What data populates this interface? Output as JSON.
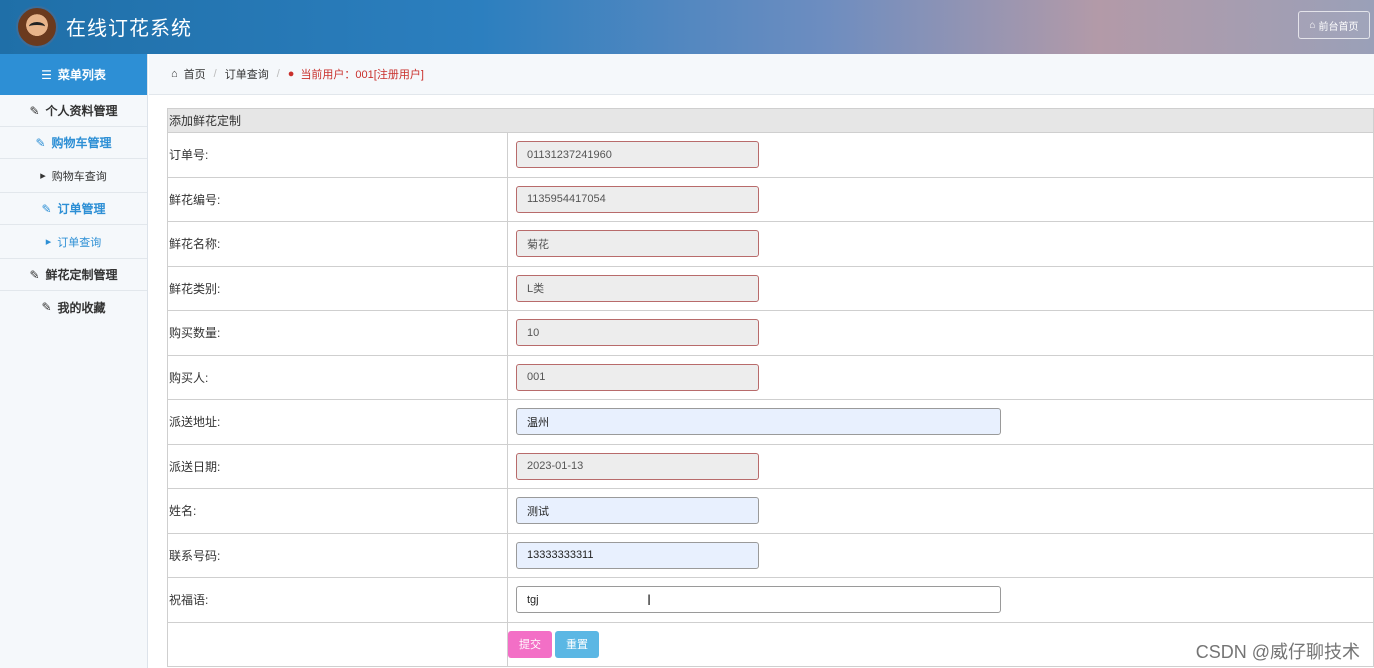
{
  "header": {
    "title": "在线订花系统",
    "front_button": "前台首页",
    "front_icon": "home-icon"
  },
  "sidebar": {
    "menu_title": "菜单列表",
    "items": [
      {
        "label": "个人资料管理",
        "type": "group"
      },
      {
        "label": "购物车管理",
        "type": "group",
        "active": true
      },
      {
        "label": "购物车查询",
        "type": "sub"
      },
      {
        "label": "订单管理",
        "type": "group",
        "active": true
      },
      {
        "label": "订单查询",
        "type": "sub",
        "active": true
      },
      {
        "label": "鲜花定制管理",
        "type": "group"
      },
      {
        "label": "我的收藏",
        "type": "group"
      }
    ]
  },
  "breadcrumb": {
    "home": "首页",
    "page": "订单查询",
    "user": "当前用户：001[注册用户]"
  },
  "form": {
    "heading": "添加鲜花定制",
    "fields": [
      {
        "label": "订单号:",
        "value": "01131237241960"
      },
      {
        "label": "鲜花编号:",
        "value": "1135954417054"
      },
      {
        "label": "鲜花名称:",
        "value": "菊花"
      },
      {
        "label": "鲜花类别:",
        "value": "L类"
      },
      {
        "label": "购买数量:",
        "value": "10"
      },
      {
        "label": "购买人:",
        "value": "001"
      },
      {
        "label": "派送地址:",
        "value": "温州"
      },
      {
        "label": "派送日期:",
        "value": "2023-01-13"
      },
      {
        "label": "姓名:",
        "value": "测试"
      },
      {
        "label": "联系号码:",
        "value": "13333333311"
      },
      {
        "label": "祝福语:",
        "value": "tgj"
      }
    ],
    "submit": "提交",
    "reset": "重置"
  },
  "watermark": "CSDN @威仔聊技术",
  "colors": {
    "accent": "#2d8fd5",
    "submit": "#f36fc6",
    "reset": "#5bb7e4",
    "user": "#c9302c"
  }
}
